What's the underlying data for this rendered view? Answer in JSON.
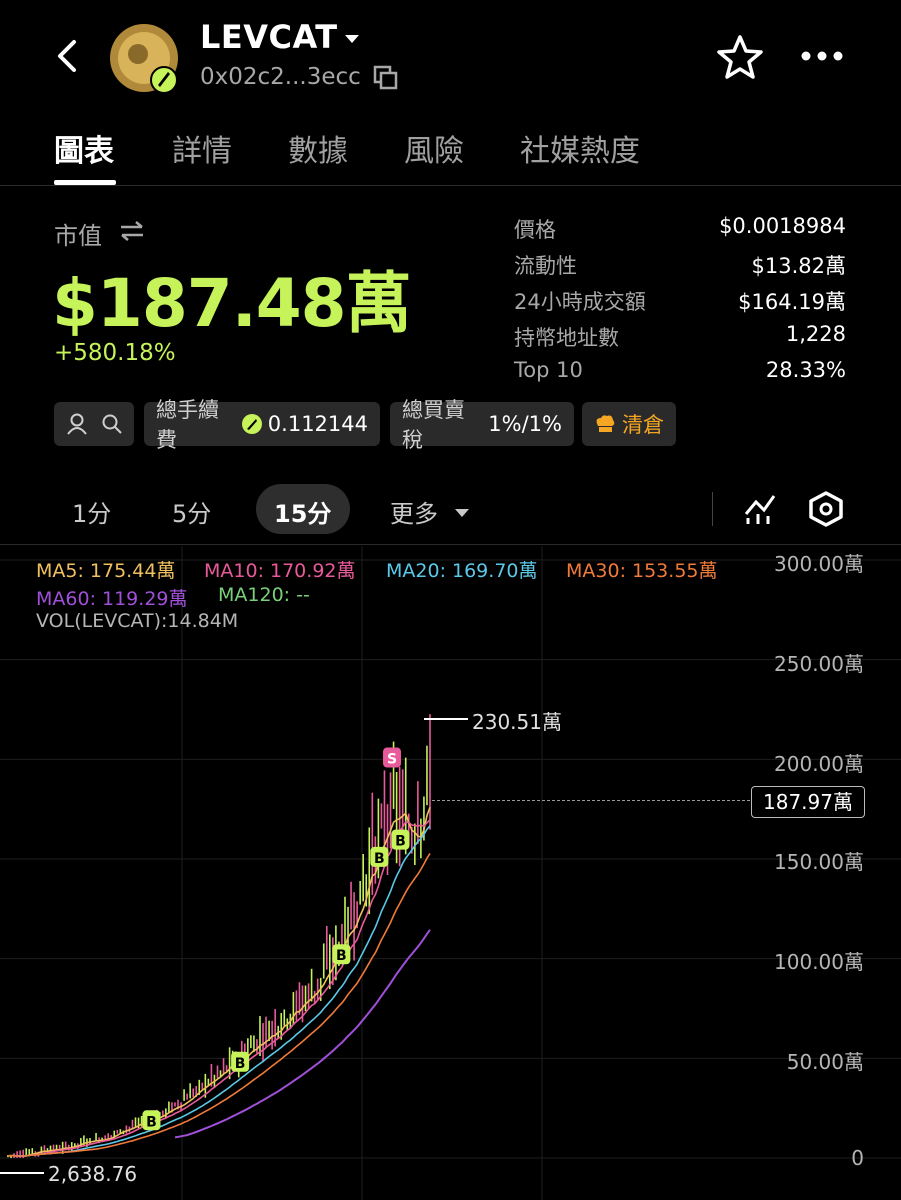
{
  "header": {
    "title": "LEVCAT",
    "address": "0x02c2...3ecc"
  },
  "tabs": [
    "圖表",
    "詳情",
    "數據",
    "風險",
    "社媒熱度"
  ],
  "market": {
    "label": "市值",
    "value": "$187.48萬",
    "change": "+580.18%"
  },
  "stats": [
    {
      "label": "價格",
      "value": "$0.0018984"
    },
    {
      "label": "流動性",
      "value": "$13.82萬"
    },
    {
      "label": "24小時成交額",
      "value": "$164.19萬"
    },
    {
      "label": "持幣地址數",
      "value": "1,228"
    },
    {
      "label": "Top 10",
      "value": "28.33%"
    }
  ],
  "pills": {
    "fee_label": "總手續費",
    "fee_value": "0.112144",
    "tax_label": "總買賣稅",
    "tax_value": "1%/1%",
    "clear_label": "清倉"
  },
  "intervals": [
    "1分",
    "5分",
    "15分",
    "更多"
  ],
  "indicators": {
    "ma5": "MA5: 175.44萬",
    "ma10": "MA10: 170.92萬",
    "ma20": "MA20: 169.70萬",
    "ma30": "MA30: 153.55萬",
    "ma60": "MA60: 119.29萬",
    "ma120": "MA120: --",
    "vol": "VOL(LEVCAT):14.84M"
  },
  "colors": {
    "accent": "#c6f25a",
    "ma5": "#f0c060",
    "ma10": "#e85a9a",
    "ma20": "#5bc8e8",
    "ma30": "#f07a3a",
    "ma60": "#a050d8",
    "ma120": "#7ad07a"
  },
  "chart_data": {
    "type": "line",
    "y_axis_labels": [
      "300.00萬",
      "250.00萬",
      "200.00萬",
      "150.00萬",
      "100.00萬",
      "50.00萬",
      "0"
    ],
    "ylim": [
      0,
      300
    ],
    "high_label": "230.51萬",
    "low_label": "2,638.76",
    "current_price_label": "187.97萬",
    "markers": [
      "B",
      "B",
      "B",
      "B",
      "B",
      "S"
    ],
    "approx_close_series": [
      1,
      2,
      4,
      5,
      8,
      10,
      14,
      18,
      22,
      28,
      35,
      42,
      50,
      58,
      66,
      75,
      85,
      100,
      120,
      150,
      175,
      160,
      187
    ]
  }
}
